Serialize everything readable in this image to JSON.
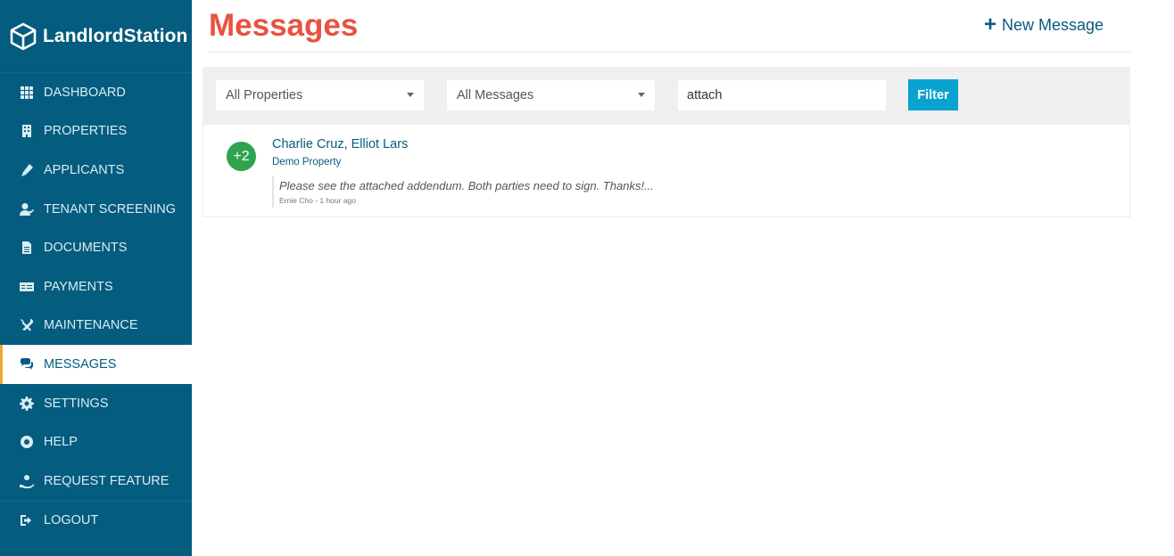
{
  "brand": {
    "name": "LandlordStation"
  },
  "sidebar": {
    "items": [
      {
        "label": "DASHBOARD",
        "icon": "grid-icon"
      },
      {
        "label": "PROPERTIES",
        "icon": "building-icon"
      },
      {
        "label": "APPLICANTS",
        "icon": "pen-icon"
      },
      {
        "label": "TENANT SCREENING",
        "icon": "user-check-icon"
      },
      {
        "label": "DOCUMENTS",
        "icon": "document-icon"
      },
      {
        "label": "PAYMENTS",
        "icon": "money-icon"
      },
      {
        "label": "MAINTENANCE",
        "icon": "tools-icon"
      },
      {
        "label": "MESSAGES",
        "icon": "chat-icon",
        "active": true
      },
      {
        "label": "SETTINGS",
        "icon": "gear-icon"
      },
      {
        "label": "HELP",
        "icon": "lifebuoy-icon"
      },
      {
        "label": "REQUEST FEATURE",
        "icon": "hand-icon"
      },
      {
        "label": "LOGOUT",
        "icon": "logout-icon"
      }
    ]
  },
  "header": {
    "title": "Messages",
    "new_message_label": "New Message"
  },
  "filters": {
    "properties_selected": "All Properties",
    "messages_selected": "All Messages",
    "search_value": "attach",
    "filter_label": "Filter"
  },
  "messages": [
    {
      "badge": "+2",
      "participants": "Charlie Cruz, Elliot Lars",
      "property": "Demo Property",
      "preview": "Please see the attached addendum. Both parties need to sign. Thanks!...",
      "meta": "Ernie Cho - 1 hour ago"
    }
  ],
  "colors": {
    "sidebar_bg": "#045c7e",
    "title": "#e8523f",
    "accent_active": "#f0a830",
    "button": "#0aa2d1",
    "badge": "#2ea44f"
  }
}
